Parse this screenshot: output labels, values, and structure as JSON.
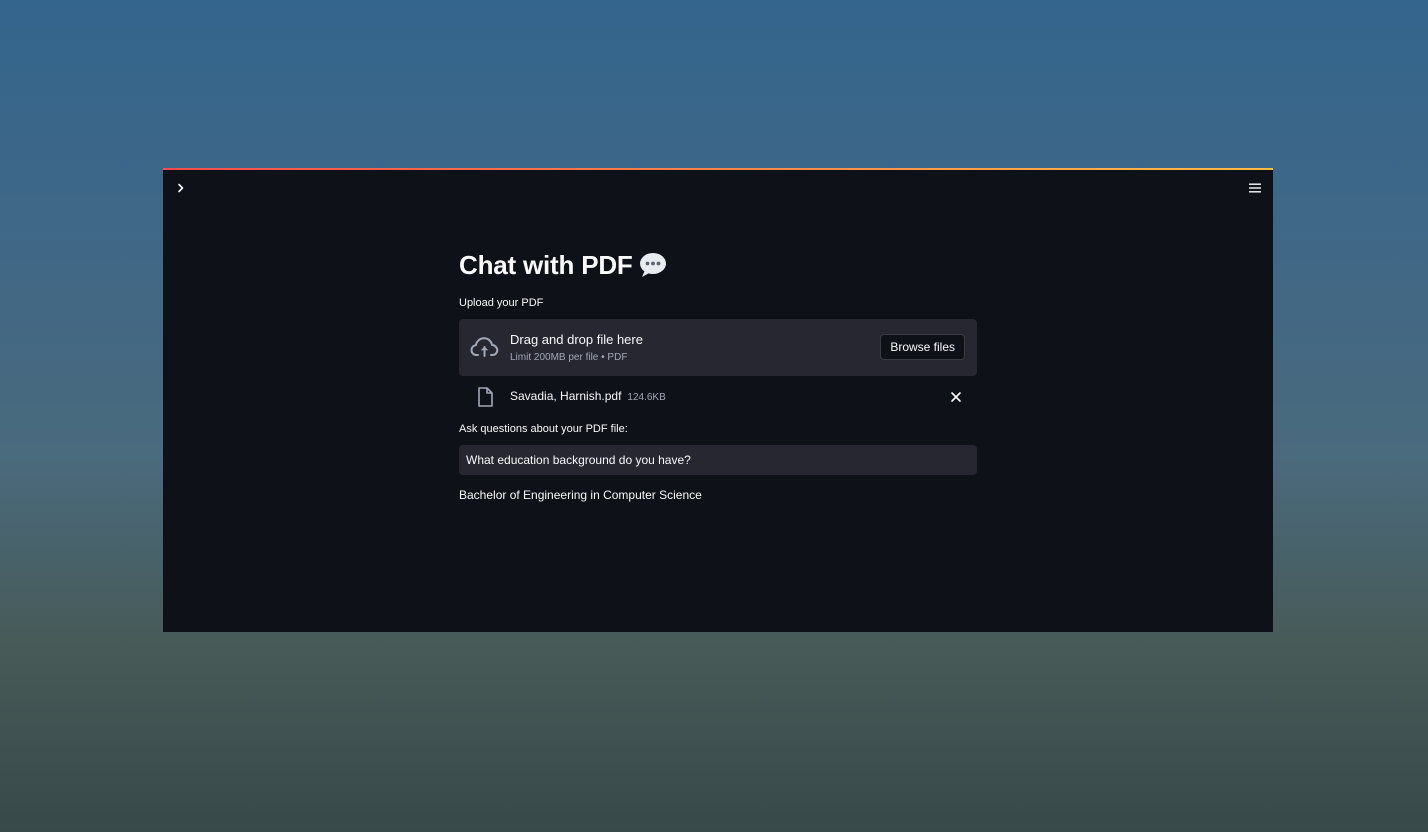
{
  "app": {
    "title": "Chat with PDF",
    "title_emoji": "speech-bubble-icon"
  },
  "uploader": {
    "label": "Upload your PDF",
    "dropzone_title": "Drag and drop file here",
    "dropzone_subtitle": "Limit 200MB per file • PDF",
    "browse_label": "Browse files"
  },
  "uploaded_file": {
    "name": "Savadia, Harnish.pdf",
    "size": "124.6KB"
  },
  "question": {
    "label": "Ask questions about your PDF file:",
    "value": "What education background do you have?"
  },
  "answer": {
    "text": "Bachelor of Engineering in Computer Science"
  },
  "colors": {
    "app_background": "#0e1117",
    "widget_background": "#262730",
    "text": "#fafafa",
    "muted_text": "#a3a8b8",
    "accent_start": "#ff4b4b",
    "accent_end": "#ffbd45"
  }
}
